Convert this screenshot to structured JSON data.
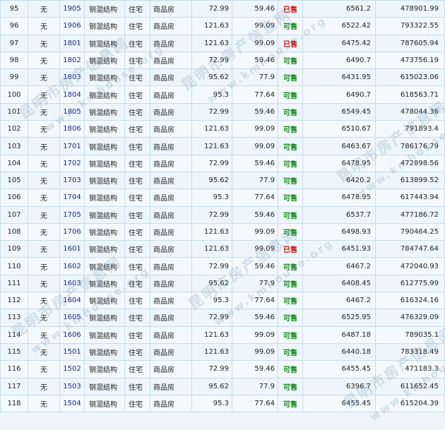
{
  "rows": [
    {
      "idx": "95",
      "mark": "无",
      "room": "1905",
      "struct": "钢混结构",
      "use": "住宅",
      "type": "商品房",
      "area": "72.99",
      "inner": "59.46",
      "status": "已售",
      "sold": true,
      "price": "6561.2",
      "total": "478901.99"
    },
    {
      "idx": "96",
      "mark": "无",
      "room": "1906",
      "struct": "钢混结构",
      "use": "住宅",
      "type": "商品房",
      "area": "121.63",
      "inner": "99.09",
      "status": "可售",
      "sold": false,
      "price": "6522.42",
      "total": "793322.55"
    },
    {
      "idx": "97",
      "mark": "无",
      "room": "1801",
      "struct": "钢混结构",
      "use": "住宅",
      "type": "商品房",
      "area": "121.63",
      "inner": "99.09",
      "status": "已售",
      "sold": true,
      "price": "6475.42",
      "total": "787605.94"
    },
    {
      "idx": "98",
      "mark": "无",
      "room": "1802",
      "struct": "钢混结构",
      "use": "住宅",
      "type": "商品房",
      "area": "72.99",
      "inner": "59.46",
      "status": "可售",
      "sold": false,
      "price": "6490.7",
      "total": "473756.19"
    },
    {
      "idx": "99",
      "mark": "无",
      "room": "1803",
      "struct": "钢混结构",
      "use": "住宅",
      "type": "商品房",
      "area": "95.62",
      "inner": "77.9",
      "status": "可售",
      "sold": false,
      "price": "6431.95",
      "total": "615023.06"
    },
    {
      "idx": "100",
      "mark": "无",
      "room": "1804",
      "struct": "钢混结构",
      "use": "住宅",
      "type": "商品房",
      "area": "95.3",
      "inner": "77.64",
      "status": "可售",
      "sold": false,
      "price": "6490.7",
      "total": "618563.71"
    },
    {
      "idx": "101",
      "mark": "无",
      "room": "1805",
      "struct": "钢混结构",
      "use": "住宅",
      "type": "商品房",
      "area": "72.99",
      "inner": "59.46",
      "status": "可售",
      "sold": false,
      "price": "6549.45",
      "total": "478044.36"
    },
    {
      "idx": "102",
      "mark": "无",
      "room": "1806",
      "struct": "钢混结构",
      "use": "住宅",
      "type": "商品房",
      "area": "121.63",
      "inner": "99.09",
      "status": "可售",
      "sold": false,
      "price": "6510.67",
      "total": "791893.4"
    },
    {
      "idx": "103",
      "mark": "无",
      "room": "1701",
      "struct": "钢混结构",
      "use": "住宅",
      "type": "商品房",
      "area": "121.63",
      "inner": "99.09",
      "status": "可售",
      "sold": false,
      "price": "6463.67",
      "total": "786176.79"
    },
    {
      "idx": "104",
      "mark": "无",
      "room": "1702",
      "struct": "钢混结构",
      "use": "住宅",
      "type": "商品房",
      "area": "72.99",
      "inner": "59.46",
      "status": "可售",
      "sold": false,
      "price": "6478.95",
      "total": "472898.56"
    },
    {
      "idx": "105",
      "mark": "无",
      "room": "1703",
      "struct": "钢混结构",
      "use": "住宅",
      "type": "商品房",
      "area": "95.62",
      "inner": "77.9",
      "status": "可售",
      "sold": false,
      "price": "6420.2",
      "total": "613899.52"
    },
    {
      "idx": "106",
      "mark": "无",
      "room": "1704",
      "struct": "钢混结构",
      "use": "住宅",
      "type": "商品房",
      "area": "95.3",
      "inner": "77.64",
      "status": "可售",
      "sold": false,
      "price": "6478.95",
      "total": "617443.94"
    },
    {
      "idx": "107",
      "mark": "无",
      "room": "1705",
      "struct": "钢混结构",
      "use": "住宅",
      "type": "商品房",
      "area": "72.99",
      "inner": "59.46",
      "status": "可售",
      "sold": false,
      "price": "6537.7",
      "total": "477186.72"
    },
    {
      "idx": "108",
      "mark": "无",
      "room": "1706",
      "struct": "钢混结构",
      "use": "住宅",
      "type": "商品房",
      "area": "121.63",
      "inner": "99.09",
      "status": "可售",
      "sold": false,
      "price": "6498.93",
      "total": "790464.25"
    },
    {
      "idx": "109",
      "mark": "无",
      "room": "1601",
      "struct": "钢混结构",
      "use": "住宅",
      "type": "商品房",
      "area": "121.63",
      "inner": "99.09",
      "status": "已售",
      "sold": true,
      "price": "6451.93",
      "total": "784747.64"
    },
    {
      "idx": "110",
      "mark": "无",
      "room": "1602",
      "struct": "钢混结构",
      "use": "住宅",
      "type": "商品房",
      "area": "72.99",
      "inner": "59.46",
      "status": "可售",
      "sold": false,
      "price": "6467.2",
      "total": "472040.93"
    },
    {
      "idx": "111",
      "mark": "无",
      "room": "1603",
      "struct": "钢混结构",
      "use": "住宅",
      "type": "商品房",
      "area": "95.62",
      "inner": "77.9",
      "status": "可售",
      "sold": false,
      "price": "6408.45",
      "total": "612775.99"
    },
    {
      "idx": "112",
      "mark": "无",
      "room": "1604",
      "struct": "钢混结构",
      "use": "住宅",
      "type": "商品房",
      "area": "95.3",
      "inner": "77.64",
      "status": "可售",
      "sold": false,
      "price": "6467.2",
      "total": "616324.16"
    },
    {
      "idx": "113",
      "mark": "无",
      "room": "1605",
      "struct": "钢混结构",
      "use": "住宅",
      "type": "商品房",
      "area": "72.99",
      "inner": "59.46",
      "status": "可售",
      "sold": false,
      "price": "6525.95",
      "total": "476329.09"
    },
    {
      "idx": "114",
      "mark": "无",
      "room": "1606",
      "struct": "钢混结构",
      "use": "住宅",
      "type": "商品房",
      "area": "121.63",
      "inner": "99.09",
      "status": "可售",
      "sold": false,
      "price": "6487.18",
      "total": "789035.1"
    },
    {
      "idx": "115",
      "mark": "无",
      "room": "1501",
      "struct": "钢混结构",
      "use": "住宅",
      "type": "商品房",
      "area": "121.63",
      "inner": "99.09",
      "status": "可售",
      "sold": false,
      "price": "6440.18",
      "total": "783318.49"
    },
    {
      "idx": "116",
      "mark": "无",
      "room": "1502",
      "struct": "钢混结构",
      "use": "住宅",
      "type": "商品房",
      "area": "72.99",
      "inner": "59.46",
      "status": "可售",
      "sold": false,
      "price": "6455.45",
      "total": "471183.3"
    },
    {
      "idx": "117",
      "mark": "无",
      "room": "1503",
      "struct": "钢混结构",
      "use": "住宅",
      "type": "商品房",
      "area": "95.62",
      "inner": "77.9",
      "status": "可售",
      "sold": false,
      "price": "6396.7",
      "total": "611652.45"
    },
    {
      "idx": "118",
      "mark": "无",
      "room": "1504",
      "struct": "钢混结构",
      "use": "住宅",
      "type": "商品房",
      "area": "95.3",
      "inner": "77.64",
      "status": "可售",
      "sold": false,
      "price": "6455.45",
      "total": "615204.39"
    }
  ],
  "watermark": {
    "cn": "昆明市房产信息网",
    "url": "www.kmhouse.org"
  },
  "colors": {
    "sold": "#cc1111",
    "available": "#118811",
    "room": "#1a2a8a"
  }
}
